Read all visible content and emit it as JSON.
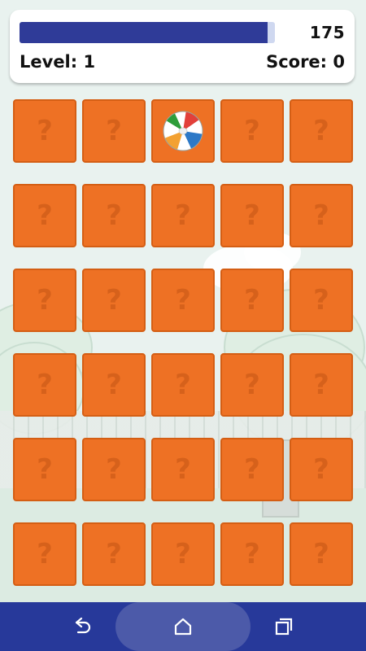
{
  "hud": {
    "timer_value": "175",
    "level_text": "Level: 1",
    "score_text": "Score: 0",
    "time_progress": 0.97
  },
  "colors": {
    "card": "#ee7124",
    "progress": "#2f3b98",
    "nav": "#27399a"
  },
  "board": {
    "rows": 6,
    "columns": 5,
    "hidden_symbol": "?",
    "revealed": [
      {
        "row": 0,
        "col": 2,
        "item": "beach-ball"
      }
    ]
  },
  "nav": {
    "back_icon": "back-icon",
    "home_icon": "home-icon",
    "recents_icon": "recents-icon"
  }
}
